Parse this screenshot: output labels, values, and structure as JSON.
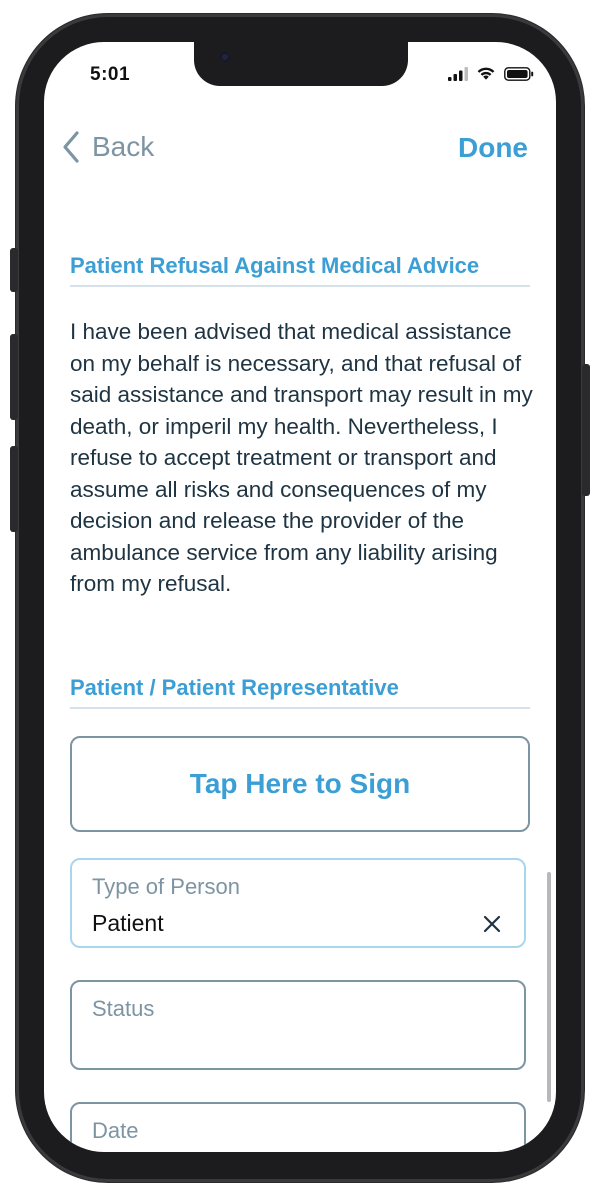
{
  "status_bar": {
    "time": "5:01",
    "icons": [
      "cellular-signal-icon",
      "wifi-icon",
      "battery-icon"
    ]
  },
  "nav": {
    "back_label": "Back",
    "done_label": "Done"
  },
  "refusal_section": {
    "title": "Patient Refusal Against Medical Advice",
    "text": "I have been advised that medical assistance on my behalf is necessary, and that refusal of said assistance and transport may result in my death, or imperil my health. Nevertheless, I refuse to accept treatment or transport and assume all risks and consequences of my decision and release the provider of the ambulance service from any liability arising from my refusal."
  },
  "representative_section": {
    "title": "Patient / Patient Representative",
    "sign_label": "Tap Here to Sign"
  },
  "fields": {
    "type_of_person": {
      "label": "Type of Person",
      "value": "Patient"
    },
    "status": {
      "label": "Status",
      "value": ""
    },
    "date": {
      "label": "Date",
      "value": ""
    }
  },
  "colors": {
    "accent": "#3b9fd5",
    "muted": "#7d94a3",
    "text": "#1f3442"
  }
}
